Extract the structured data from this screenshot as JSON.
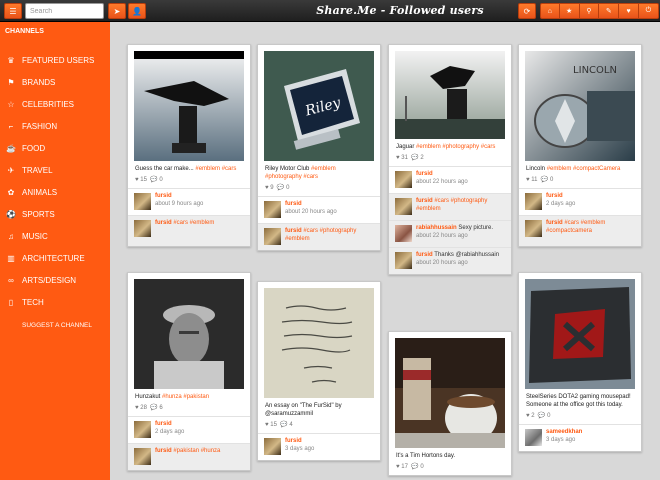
{
  "header": {
    "title": "Share.Me - Followed users",
    "menu_icon": "menu-icon",
    "search_placeholder": "Search",
    "nav_icons": [
      "home-icon",
      "star-icon",
      "location-icon",
      "pen-icon",
      "heart-icon",
      "power-icon"
    ]
  },
  "sidebar": {
    "heading": "CHANNELS",
    "items": [
      {
        "label": "FEATURED USERS",
        "icon": "crown-icon"
      },
      {
        "label": "BRANDS",
        "icon": "tag-icon"
      },
      {
        "label": "CELEBRITIES",
        "icon": "star-icon"
      },
      {
        "label": "FASHION",
        "icon": "shoe-icon"
      },
      {
        "label": "FOOD",
        "icon": "food-icon"
      },
      {
        "label": "TRAVEL",
        "icon": "plane-icon"
      },
      {
        "label": "ANIMALS",
        "icon": "paw-icon"
      },
      {
        "label": "SPORTS",
        "icon": "ball-icon"
      },
      {
        "label": "MUSIC",
        "icon": "music-icon"
      },
      {
        "label": "ARCHITECTURE",
        "icon": "building-icon"
      },
      {
        "label": "ARTS/DESIGN",
        "icon": "glasses-icon"
      },
      {
        "label": "TECH",
        "icon": "phone-icon"
      }
    ],
    "suggest": "SUGGEST A CHANNEL"
  },
  "colors": {
    "accent": "#ff5a12",
    "topbar": "#2b2b2b",
    "background": "#d8d8d8"
  },
  "cards": [
    {
      "caption": "Guess the car make...",
      "tags": "#emblem #cars",
      "likes": "15",
      "comments": "0",
      "rows": [
        {
          "user": "fursid",
          "text": "",
          "time": "about 9 hours ago"
        },
        {
          "user": "fursid",
          "text": "#cars #emblem",
          "time": ""
        }
      ]
    },
    {
      "caption": "Riley Motor Club",
      "tags": "#emblem #photography #cars",
      "likes": "9",
      "comments": "0",
      "rows": [
        {
          "user": "fursid",
          "text": "",
          "time": "about 20 hours ago"
        },
        {
          "user": "fursid",
          "text": "#cars #photography #emblem",
          "time": ""
        }
      ]
    },
    {
      "caption": "Jaguar",
      "tags": "#emblem #photography #cars",
      "likes": "31",
      "comments": "2",
      "rows": [
        {
          "user": "fursid",
          "text": "",
          "time": "about 22 hours ago"
        },
        {
          "user": "fursid",
          "text": "#cars #photography #emblem",
          "time": ""
        },
        {
          "user": "rabiahhussain",
          "text": "Sexy picture.",
          "time": "about 22 hours ago"
        },
        {
          "user": "fursid",
          "text": "Thanks @rabiahhussain",
          "time": "about 20 hours ago"
        }
      ]
    },
    {
      "caption": "Lincoln",
      "tags": "#emblem #compactCamera",
      "likes": "11",
      "comments": "0",
      "rows": [
        {
          "user": "fursid",
          "text": "",
          "time": "2 days ago"
        },
        {
          "user": "fursid",
          "text": "#cars #emblem #compactcamera",
          "time": ""
        }
      ]
    },
    {
      "caption": "Hunzakut",
      "tags": "#hunza #pakistan",
      "likes": "28",
      "comments": "6",
      "rows": [
        {
          "user": "fursid",
          "text": "",
          "time": "2 days ago"
        },
        {
          "user": "fursid",
          "text": "#pakistan #hunza",
          "time": ""
        }
      ]
    },
    {
      "caption": "An essay on \"The FurSid\" by @saramuzzammil",
      "tags": "",
      "likes": "15",
      "comments": "4",
      "rows": [
        {
          "user": "fursid",
          "text": "",
          "time": "3 days ago"
        }
      ]
    },
    {
      "caption": "It's a Tim Hortons day.",
      "tags": "",
      "likes": "17",
      "comments": "0",
      "rows": []
    },
    {
      "caption": "SteelSeries DOTA2 gaming mousepad! Someone at the office got this today.",
      "tags": "",
      "likes": "2",
      "comments": "0",
      "rows": [
        {
          "user": "sameedkhan",
          "text": "",
          "time": "3 days ago"
        }
      ]
    }
  ]
}
